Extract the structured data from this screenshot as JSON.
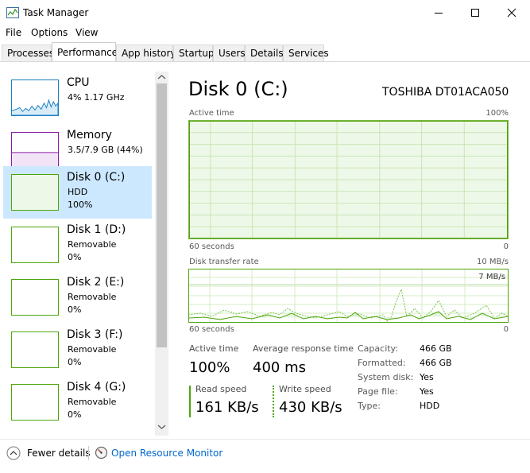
{
  "window": {
    "title": "Task Manager"
  },
  "menu": [
    "File",
    "Options",
    "View"
  ],
  "tabs": [
    "Processes",
    "Performance",
    "App history",
    "Startup",
    "Users",
    "Details",
    "Services"
  ],
  "active_tab": "Performance",
  "sidebar": {
    "items": [
      {
        "title": "CPU",
        "line1": "4%  1.17 GHz",
        "line2": "",
        "color": "#1a7fc1"
      },
      {
        "title": "Memory",
        "line1": "3.5/7.9 GB (44%)",
        "line2": "",
        "color": "#8b1aa8"
      },
      {
        "title": "Disk 0 (C:)",
        "line1": "HDD",
        "line2": "100%",
        "color": "#4da60c",
        "selected": true
      },
      {
        "title": "Disk 1 (D:)",
        "line1": "Removable",
        "line2": "0%",
        "color": "#4da60c"
      },
      {
        "title": "Disk 2 (E:)",
        "line1": "Removable",
        "line2": "0%",
        "color": "#4da60c"
      },
      {
        "title": "Disk 3 (F:)",
        "line1": "Removable",
        "line2": "0%",
        "color": "#4da60c"
      },
      {
        "title": "Disk 4 (G:)",
        "line1": "Removable",
        "line2": "0%",
        "color": "#4da60c"
      }
    ]
  },
  "main": {
    "title": "Disk 0 (C:)",
    "model": "TOSHIBA DT01ACA050",
    "active_time_graph": {
      "label": "Active time",
      "max": "100%",
      "x_left": "60 seconds",
      "x_right": "0"
    },
    "transfer_graph": {
      "label": "Disk transfer rate",
      "max": "10 MB/s",
      "marker": "7 MB/s",
      "x_left": "60 seconds",
      "x_right": "0"
    },
    "stats": {
      "active_time_label": "Active time",
      "active_time_value": "100%",
      "avg_response_label": "Average response time",
      "avg_response_value": "400 ms",
      "read_label": "Read speed",
      "read_value": "161 KB/s",
      "write_label": "Write speed",
      "write_value": "430 KB/s"
    },
    "info": [
      {
        "label": "Capacity:",
        "value": "466 GB"
      },
      {
        "label": "Formatted:",
        "value": "466 GB"
      },
      {
        "label": "System disk:",
        "value": "Yes"
      },
      {
        "label": "Page file:",
        "value": "Yes"
      },
      {
        "label": "Type:",
        "value": "HDD"
      }
    ]
  },
  "footer": {
    "fewer_details": "Fewer details",
    "resource_monitor": "Open Resource Monitor"
  },
  "colors": {
    "accent": "#4da60c",
    "selected": "#cce8ff",
    "link": "#0066cc"
  }
}
